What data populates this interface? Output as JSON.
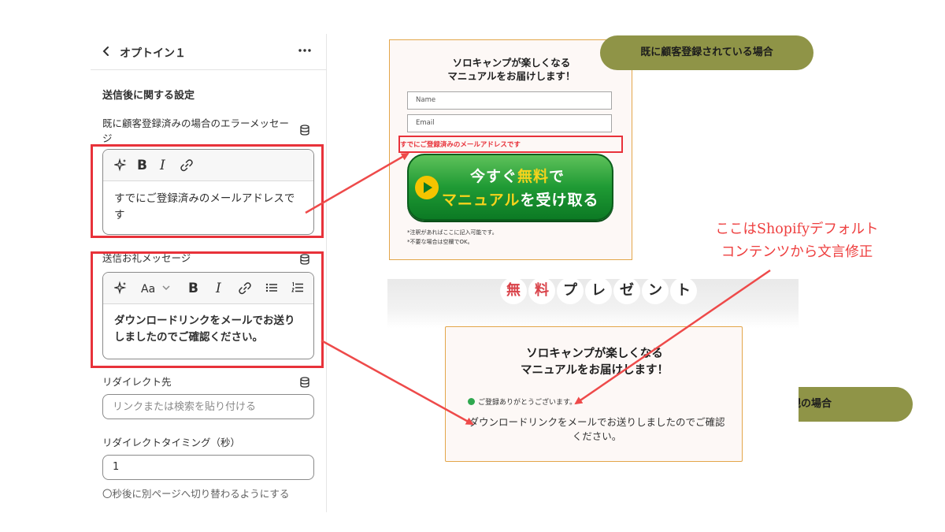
{
  "panel": {
    "title": "オプトイン１",
    "section_title": "送信後に関する設定",
    "error_field": {
      "label": "既に顧客登録済みの場合のエラーメッセージ",
      "value": "すでにご登録済みのメールアドレスです"
    },
    "thanks_field": {
      "label": "送信お礼メッセージ",
      "value": "ダウンロードリンクをメールでお送りしましたのでご確認ください。"
    },
    "redirect_field": {
      "label": "リダイレクト先",
      "placeholder": "リンクまたは検索を貼り付ける"
    },
    "timing_field": {
      "label": "リダイレクトタイミング（秒）",
      "value": "1",
      "help": "〇秒後に別ページへ切り替わるようにする"
    },
    "toolbar_icons": [
      "sparkle-icon",
      "bold-icon",
      "italic-icon",
      "link-icon",
      "font-size-icon",
      "bullet-list-icon",
      "numbered-list-icon"
    ]
  },
  "preview_existing": {
    "headline": [
      "ソロキャンプが楽しくなる",
      "マニュアルをお届けします！"
    ],
    "name_placeholder": "Name",
    "email_placeholder": "Email",
    "error_text": "すでにご登録済みのメールアドレスです",
    "cta_line1": [
      "今すぐ",
      "無料",
      "で"
    ],
    "cta_line2": [
      "マニュアル",
      "を受け取る"
    ],
    "note1": "*注釈があればここに記入可能です。",
    "note2": "*不要な場合は空欄でOK。"
  },
  "preview_new": {
    "present_chars": [
      "無",
      "料",
      "プ",
      "レ",
      "ゼ",
      "ン",
      "ト"
    ],
    "headline": [
      "ソロキャンプが楽しくなる",
      "マニュアルをお届けします！"
    ],
    "success_text": "ご登録ありがとうございます。",
    "message": "ダウンロードリンクをメールでお送りしましたのでご確認ください。"
  },
  "labels": {
    "existing_case": "既に顧客登録されている場合",
    "new_case": "新規の場合",
    "annotation_line1": "ここはShopifyデフォルト",
    "annotation_line2": "コンテンツから文言修正"
  },
  "colors": {
    "highlight_red": "#e8323a",
    "pill_olive": "#8f9447",
    "cta_green": "#1f9a34",
    "cta_yellow": "#f7d31c",
    "frame_orange": "#e3a64a"
  }
}
